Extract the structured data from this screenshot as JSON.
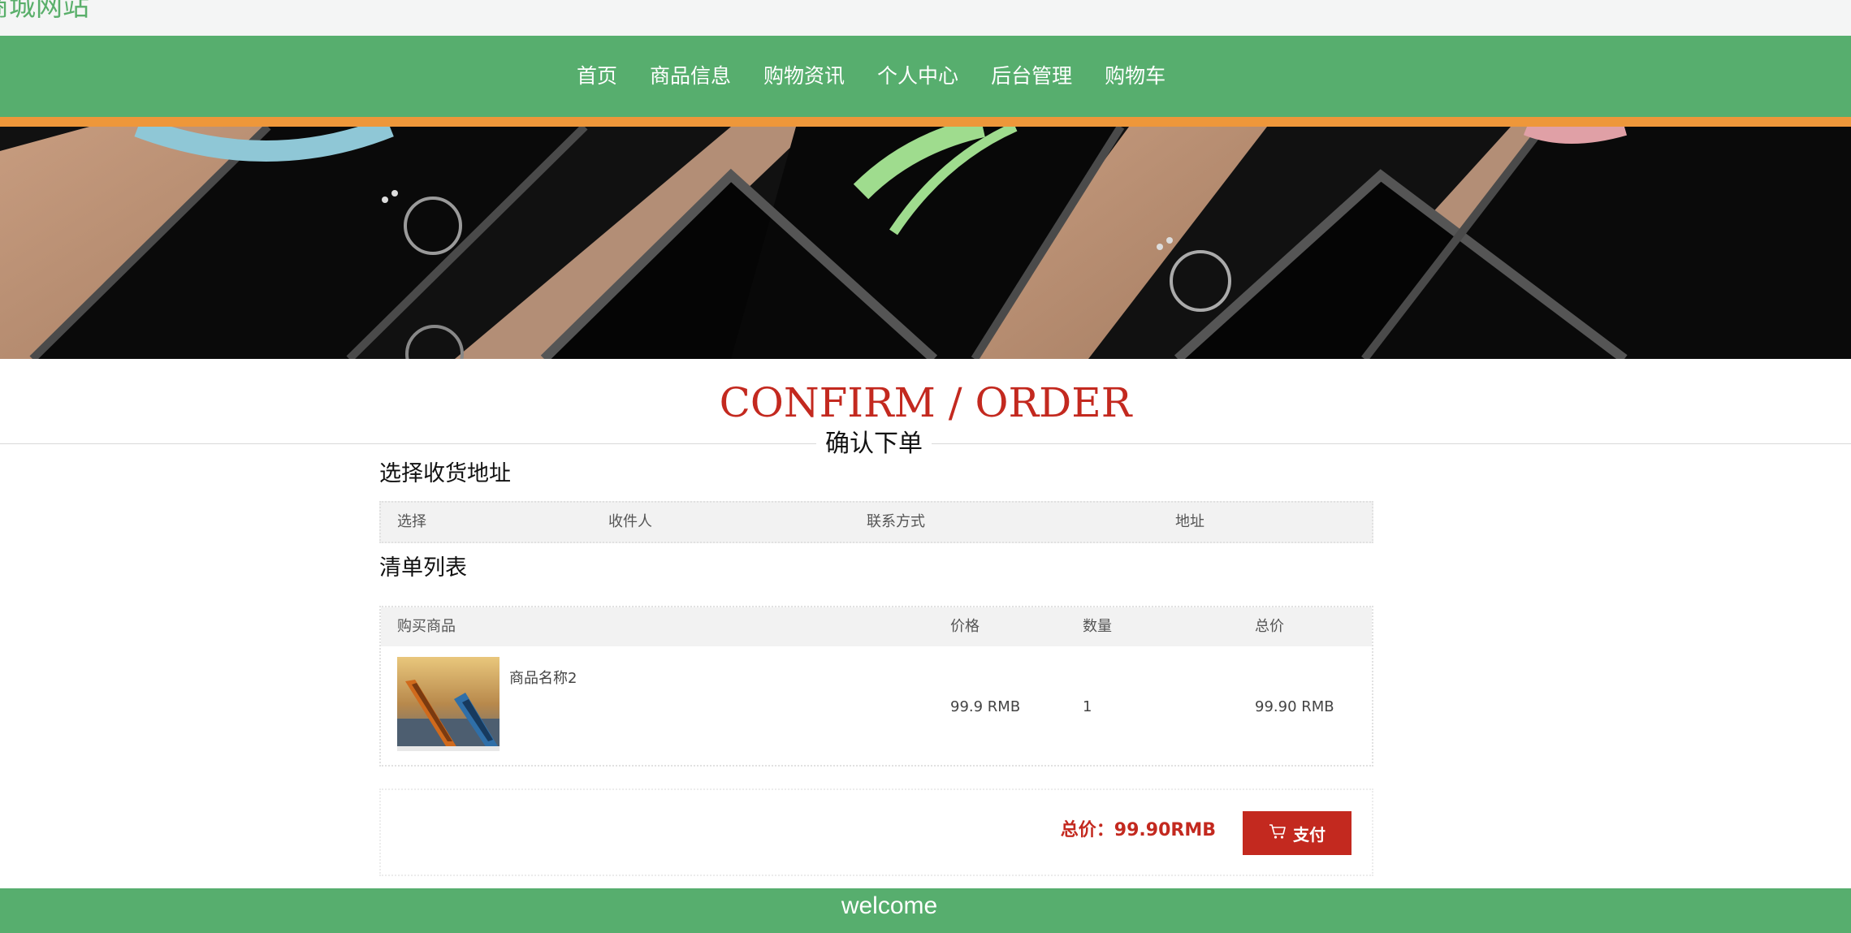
{
  "header": {
    "site_title": "商城网站"
  },
  "nav": {
    "items": [
      {
        "label": "首页"
      },
      {
        "label": "商品信息"
      },
      {
        "label": "购物资讯"
      },
      {
        "label": "个人中心"
      },
      {
        "label": "后台管理"
      },
      {
        "label": "购物车"
      }
    ]
  },
  "page": {
    "heading_en": "CONFIRM / ORDER",
    "heading_cn": "确认下单"
  },
  "address_section": {
    "title": "选择收货地址",
    "columns": [
      "选择",
      "收件人",
      "联系方式",
      "地址"
    ]
  },
  "items_section": {
    "title": "清单列表",
    "columns": [
      "购买商品",
      "价格",
      "数量",
      "总价"
    ],
    "rows": [
      {
        "name": "商品名称2",
        "price": "99.9 RMB",
        "quantity": "1",
        "total": "99.90 RMB"
      }
    ]
  },
  "payment": {
    "total_label": "总价：99.90RMB",
    "pay_label": "支付",
    "pay_icon": "shopping-cart-icon"
  },
  "footer": {
    "text": "welcome"
  },
  "colors": {
    "nav_green": "#57ae6e",
    "accent_orange": "#ee973a",
    "accent_red": "#c3291f"
  }
}
